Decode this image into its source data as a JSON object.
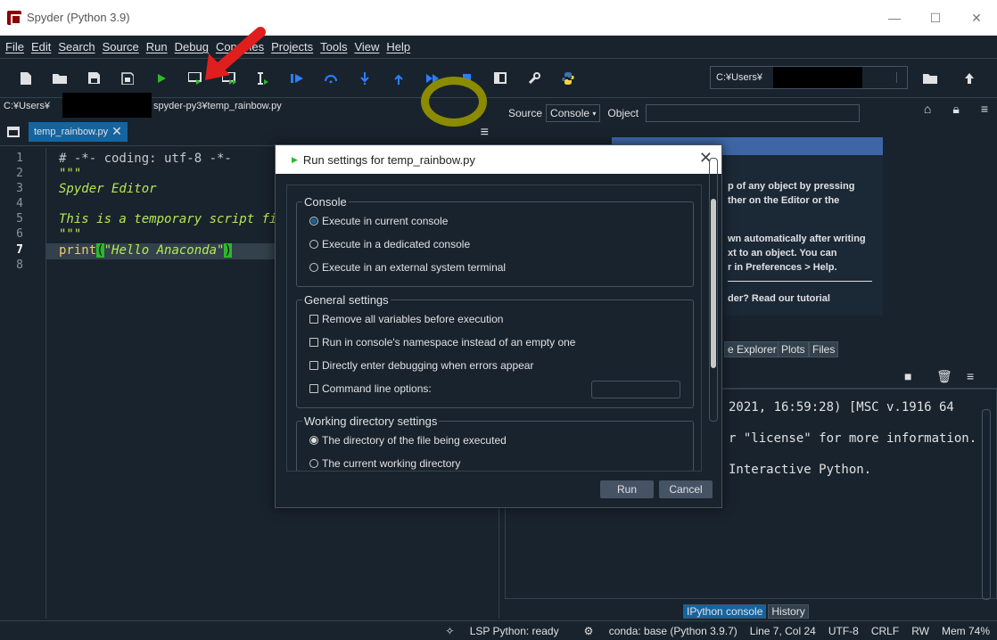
{
  "window": {
    "title": "Spyder (Python 3.9)",
    "minimize": "—",
    "maximize": "☐",
    "close": "✕"
  },
  "menu": [
    "File",
    "Edit",
    "Search",
    "Source",
    "Run",
    "Debug",
    "Consoles",
    "Projects",
    "Tools",
    "View",
    "Help"
  ],
  "toolbar": {
    "path": "C:¥Users¥"
  },
  "editor": {
    "path_prefix": "C:¥Users¥",
    "path_suffix": "spyder-py3¥temp_rainbow.py",
    "tab_label": "temp_rainbow.py",
    "tab_close": "✕",
    "lines": [
      {
        "n": "1",
        "text": "# -*- coding: utf-8 -*-"
      },
      {
        "n": "2",
        "text": "\"\"\""
      },
      {
        "n": "3",
        "text": "Spyder Editor"
      },
      {
        "n": "4",
        "text": ""
      },
      {
        "n": "5",
        "text": "This is a temporary script fil"
      },
      {
        "n": "6",
        "text": "\"\"\""
      },
      {
        "n": "7",
        "text_kw": "print",
        "text_open": "(",
        "text_str": "\"Hello Anaconda\"",
        "text_close": ")"
      },
      {
        "n": "8",
        "text": ""
      }
    ]
  },
  "help": {
    "source_label": "Source",
    "source_value": "Console",
    "object_label": "Object",
    "lines": [
      "p of any object by pressing",
      "ther on the Editor or the",
      "wn automatically after writing",
      "xt to an object. You can",
      "r in Preferences > Help.",
      "der? Read our tutorial"
    ]
  },
  "right_tabs": [
    "e Explorer",
    "Plots",
    "Files"
  ],
  "console": {
    "lines": [
      "2021, 16:59:28) [MSC v.1916 64",
      "r \"license\" for more information.",
      "Interactive Python."
    ]
  },
  "bottom_tabs": [
    "IPython console",
    "History"
  ],
  "status": {
    "lsp": "LSP Python: ready",
    "conda": "conda: base (Python 3.9.7)",
    "position": "Line 7, Col 24",
    "encoding": "UTF-8",
    "eol": "CRLF",
    "rw": "RW",
    "mem": "Mem 74%"
  },
  "dialog": {
    "title": "Run settings for temp_rainbow.py",
    "close": "✕",
    "console_group": "Console",
    "console_options": [
      "Execute in current console",
      "Execute in a dedicated console",
      "Execute in an external system terminal"
    ],
    "general_group": "General settings",
    "general_options": [
      "Remove all variables before execution",
      "Run in console's namespace instead of an empty one",
      "Directly enter debugging when errors appear",
      "Command line options:"
    ],
    "workdir_group": "Working directory settings",
    "workdir_options": [
      "The directory of the file being executed",
      "The current working directory"
    ],
    "run_button": "Run",
    "cancel_button": "Cancel"
  },
  "colors": {
    "background": "#19232d",
    "accent": "#1464a0",
    "run_green": "#2eb82e",
    "annotation_red": "#e01e1e",
    "annotation_olive": "#8b8b00"
  }
}
